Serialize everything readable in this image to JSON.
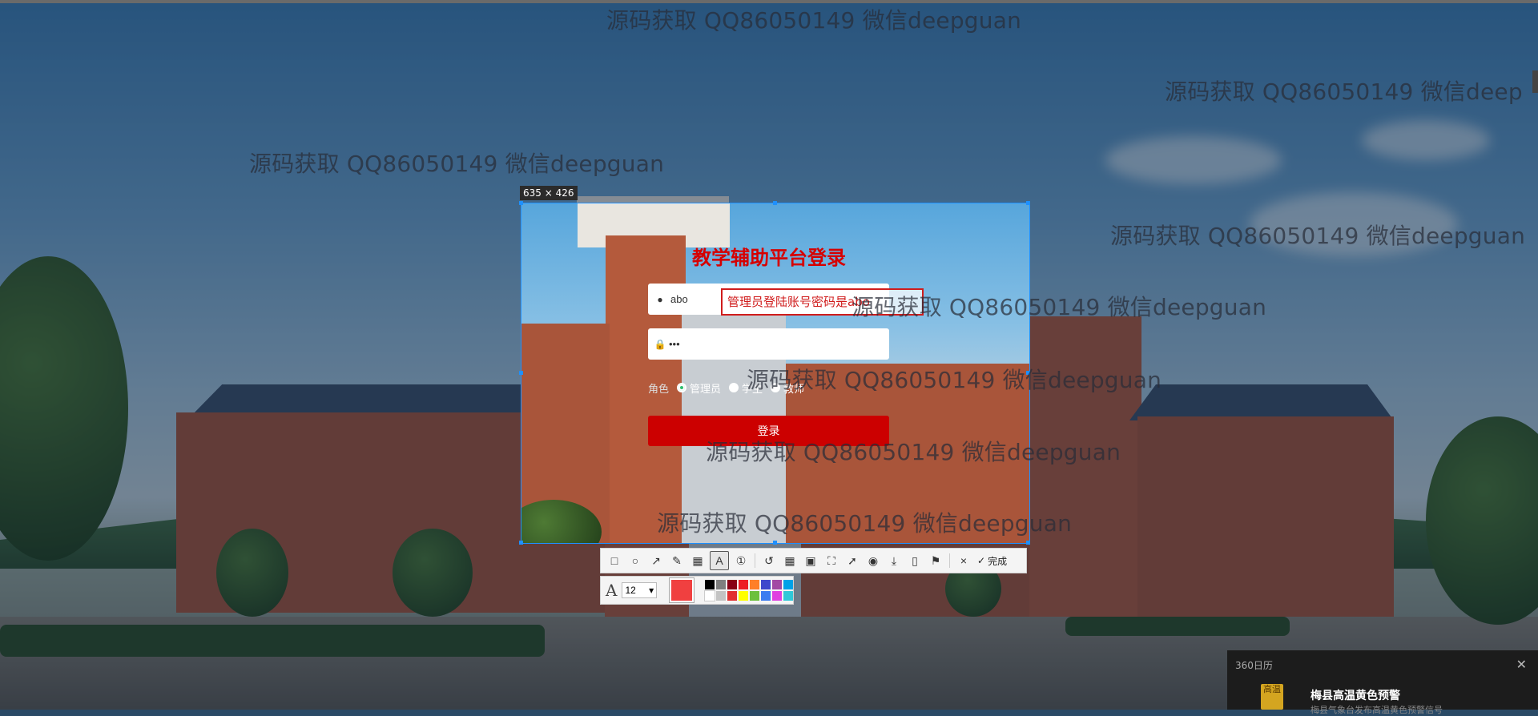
{
  "watermark_text": "源码获取 QQ86050149 微信deepguan",
  "watermark_cut_text": "源码获取 QQ86050149 微信deep",
  "selection": {
    "size_label": "635 × 426"
  },
  "login": {
    "title": "教学辅助平台登录",
    "username_value": "abo",
    "password_value": "•••",
    "tooltip": "管理员登陆账号密码是abo",
    "role_label": "角色",
    "roles": [
      "管理员",
      "学生",
      "教师"
    ],
    "selected_role": "管理员",
    "submit_label": "登录"
  },
  "toolbar": {
    "tools": [
      "rectangle-icon",
      "ellipse-icon",
      "arrow-icon",
      "pen-icon",
      "mosaic-icon",
      "text-icon",
      "number-icon",
      "undo-icon",
      "ocr-icon",
      "translate-icon",
      "scroll-capture-icon",
      "pin-icon",
      "record-icon",
      "download-icon",
      "phone-icon",
      "bookmark-icon"
    ],
    "cancel_label": "×",
    "done_label": "完成"
  },
  "subbar": {
    "font_size": "12",
    "current_color": "#f04040",
    "palette": [
      "#000000",
      "#7f7f7f",
      "#880015",
      "#ed1c24",
      "#ff7f27",
      "#3f48cc",
      "#a349a4",
      "#00a2e8",
      "#ffffff",
      "#c3c3c3",
      "#e13030",
      "#ffff00",
      "#6cc03c",
      "#3c7cf0",
      "#e040e0",
      "#30c8d8"
    ]
  },
  "notification": {
    "app": "360日历",
    "title": "梅县高温黄色预警",
    "subtitle": "梅县气象台发布高温黄色预警信号",
    "icon_text": "高温"
  }
}
